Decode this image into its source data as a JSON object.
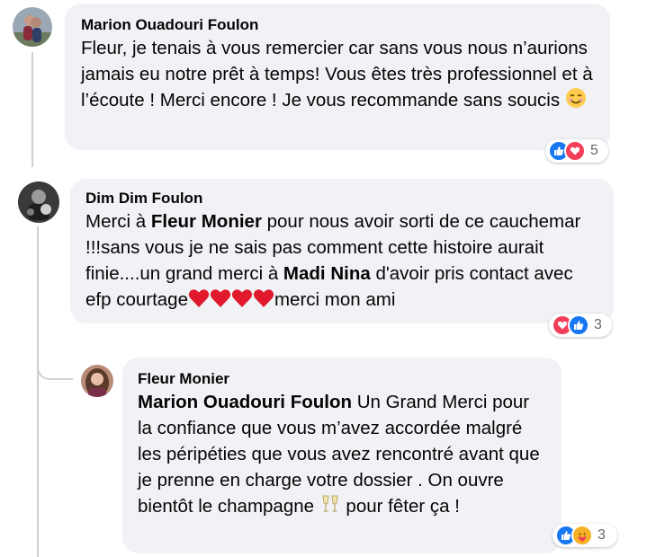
{
  "comments": [
    {
      "author": "Marion Ouadouri Foulon",
      "text": "Fleur, je tenais à vous remercier car sans vous nous n’aurions jamais eu notre prêt à temps! Vous êtes très professionnel et à l’écoute ! Merci encore ! Je vous recommande sans soucis",
      "reactions": {
        "icons": [
          "like-icon",
          "love-icon"
        ],
        "count": "5"
      }
    },
    {
      "author": "Dim Dim Foulon",
      "text_1": "Merci à ",
      "mention_1": "Fleur Monier",
      "text_2": " pour nous avoir sorti de ce cauchemar !!!sans vous je ne sais pas comment cette histoire aurait finie....un grand merci à ",
      "mention_2": "Madi Nina",
      "text_3": " d'avoir pris contact avec efp courtage",
      "text_4": "merci mon ami",
      "reactions": {
        "icons": [
          "love-icon",
          "like-icon"
        ],
        "count": "3"
      }
    },
    {
      "author": "Fleur Monier",
      "mention_1": "Marion Ouadouri Foulon",
      "text_1": " Un Grand Merci pour la confiance que vous m’avez accordée malgré les péripéties que vous avez rencontré avant que je prenne en charge votre dossier . On ouvre bientôt le champagne ",
      "text_2": " pour fêter ça !",
      "reactions": {
        "icons": [
          "like-icon",
          "care-icon"
        ],
        "count": "3"
      }
    }
  ],
  "colors": {
    "like": "#1877f2",
    "love": "#f33e58",
    "care": "#f7b125",
    "bubble": "#f0f2f5"
  }
}
